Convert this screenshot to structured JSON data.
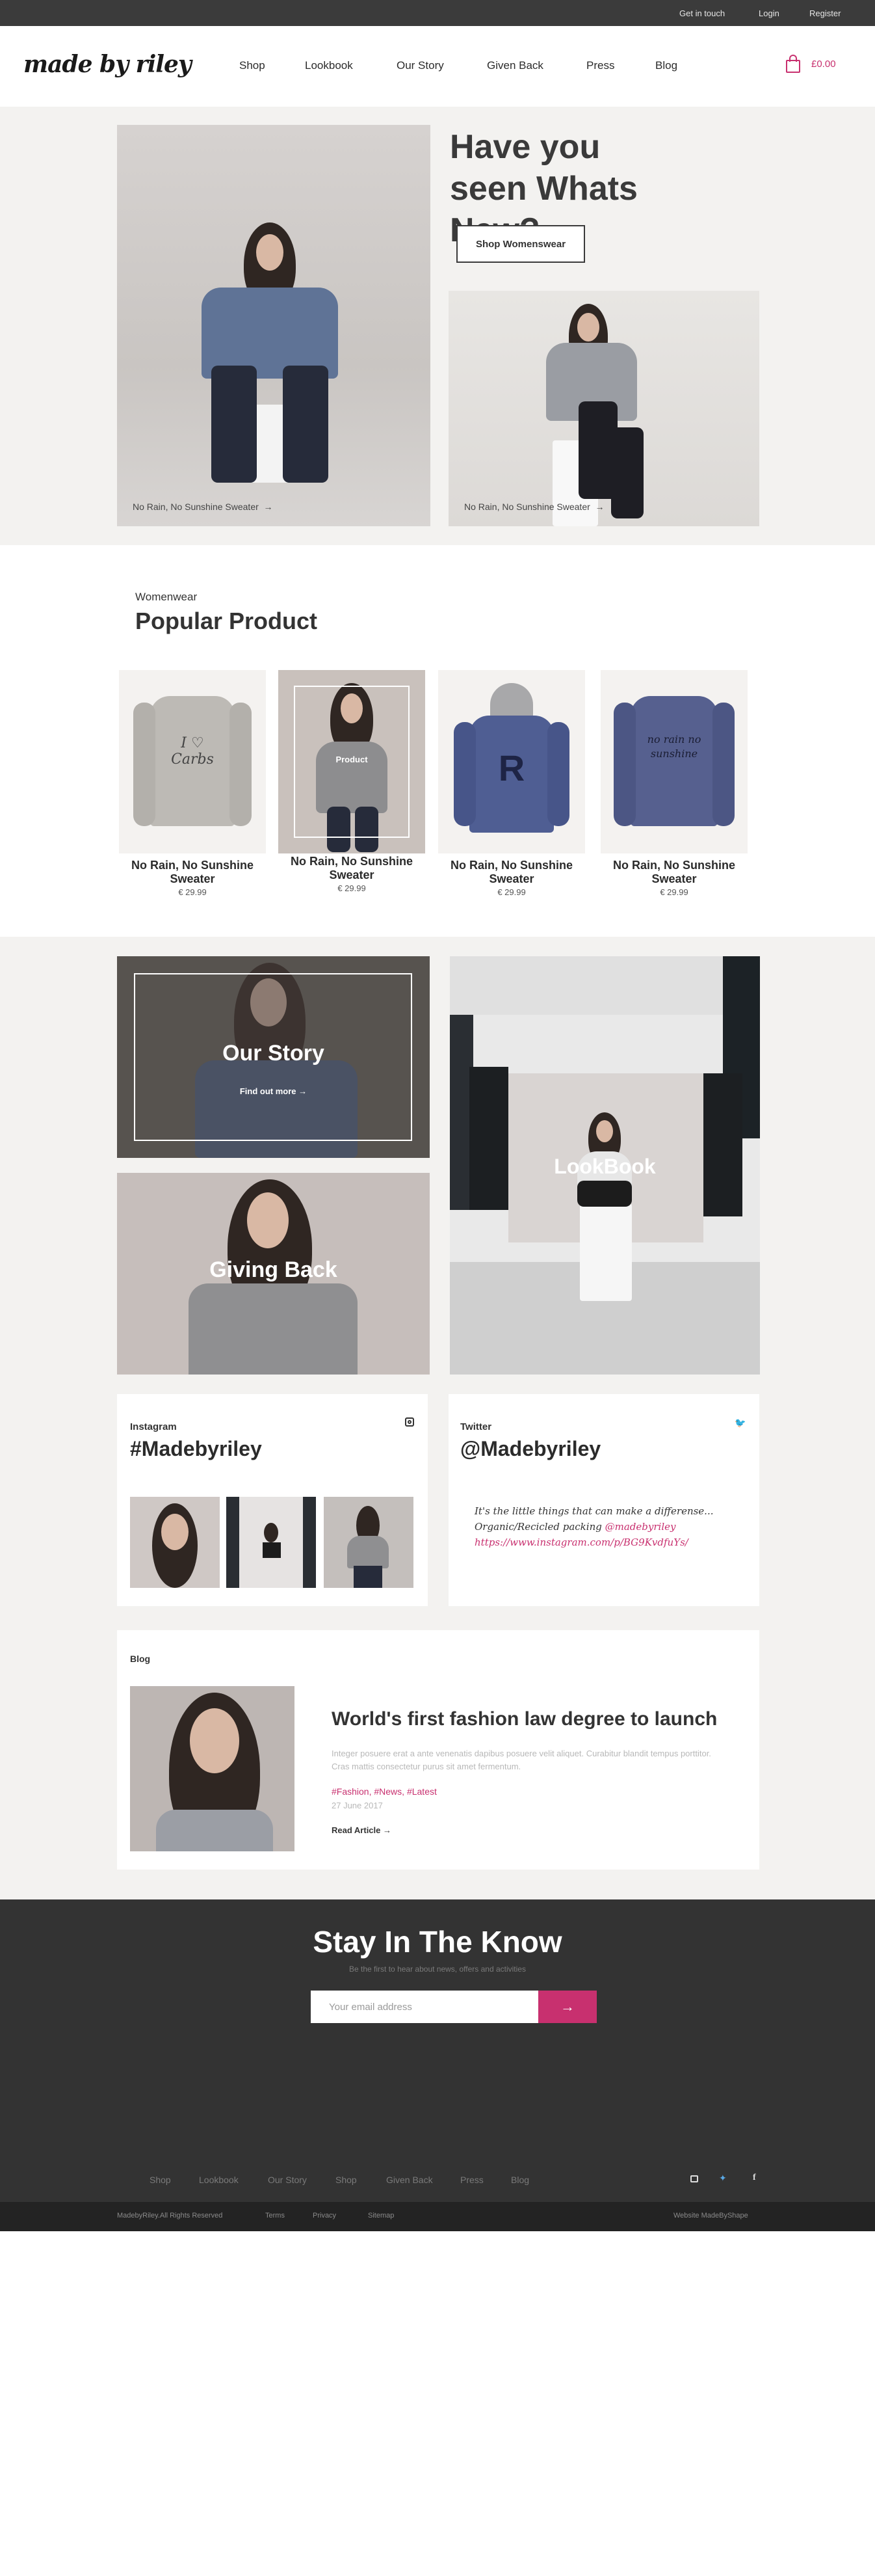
{
  "topbar": {
    "links": [
      "Get in touch",
      "Login",
      "Register"
    ]
  },
  "header": {
    "logo": "made by riley",
    "nav": [
      "Shop",
      "Lookbook",
      "Our Story",
      "Given Back",
      "Press",
      "Blog"
    ],
    "cart_total": "£0.00"
  },
  "hero": {
    "title": "Have you seen Whats New?",
    "button": "Shop Womenswear",
    "caption_left": "No Rain, No Sunshine Sweater",
    "caption_right": "No Rain, No Sunshine Sweater",
    "slides": 3
  },
  "products": {
    "kicker": "Womenwear",
    "title": "Popular Product",
    "items": [
      {
        "name": "No Rain, No Sunshine Sweater",
        "price": "€ 29.99",
        "print": "I ♡ Carbs"
      },
      {
        "name": "No Rain, No Sunshine Sweater",
        "price": "€ 29.99",
        "print": "Product"
      },
      {
        "name": "No Rain, No Sunshine Sweater",
        "price": "€ 29.99",
        "print": "R"
      },
      {
        "name": "No Rain, No Sunshine Sweater",
        "price": "€ 29.99",
        "print": "no rain no sunshine"
      }
    ]
  },
  "mosaic": {
    "story_title": "Our Story",
    "story_link": "Find out more  →",
    "giving_back": "Giving Back",
    "lookbook": "LookBook"
  },
  "instagram": {
    "kicker": "Instagram",
    "handle": "#Madebyriley"
  },
  "twitter": {
    "kicker": "Twitter",
    "handle": "@Madebyriley",
    "tweet_line1": "It's the little things that can make a differense...",
    "tweet_line2": "Organic/Recicled packing",
    "tweet_mention": "@madebyriley",
    "tweet_link": "https://www.instagram.com/p/BG9KvdfuYs/"
  },
  "blog": {
    "kicker": "Blog",
    "title": "World's first fashion law degree to launch",
    "excerpt": "Integer posuere erat a ante venenatis dapibus posuere velit aliquet. Curabitur blandit tempus porttitor. Cras mattis consectetur purus sit amet fermentum.",
    "tags": "#Fashion, #News, #Latest",
    "date": "27 June 2017",
    "read_more": "Read Article →"
  },
  "newsletter": {
    "title": "Stay In The Know",
    "subtitle": "Be the first to hear about news, offers and activities",
    "placeholder": "Your email address",
    "button": "→"
  },
  "footer": {
    "nav": [
      "Shop",
      "Lookbook",
      "Our Story",
      "Shop",
      "Given Back",
      "Press",
      "Blog"
    ],
    "copyright": "MadebyRiley.All Rights Reserved",
    "legal_links": [
      "Terms",
      "Privacy",
      "Sitemap"
    ],
    "credit": "Website MadeByShape"
  },
  "colors": {
    "accent": "#c8306f",
    "dark": "#333333",
    "footer": "#232323",
    "light_bg": "#f3f2f0"
  }
}
